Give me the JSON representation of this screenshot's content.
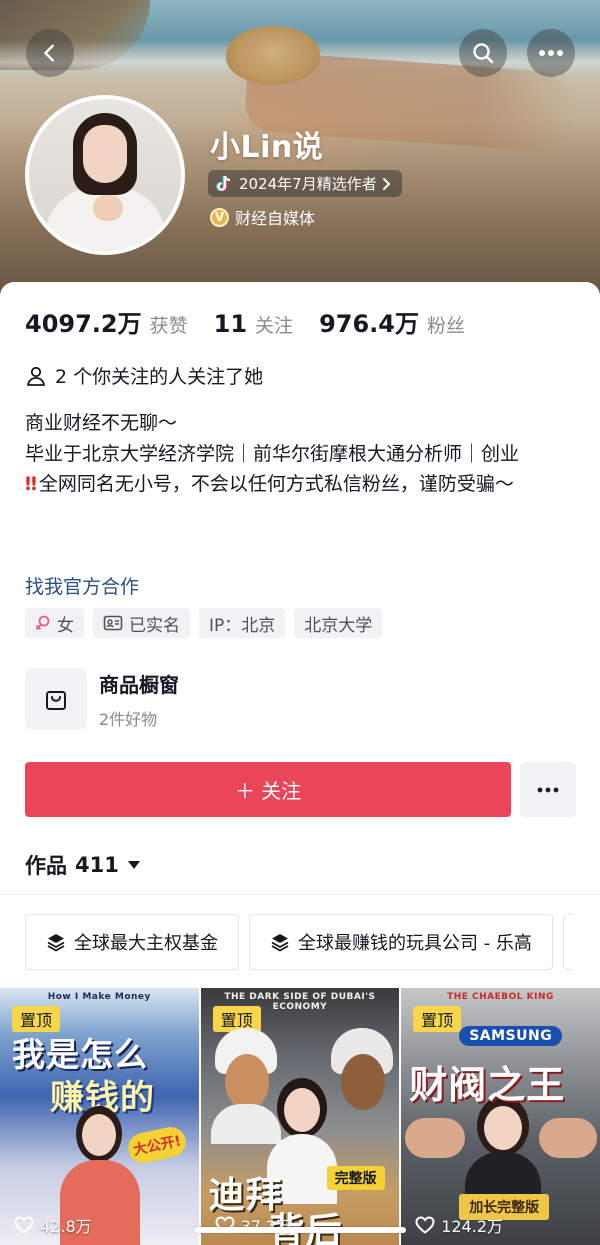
{
  "header": {
    "back_icon": "chevron-left-icon",
    "search_icon": "search-icon",
    "more_icon": "ellipsis-icon"
  },
  "profile": {
    "name": "小Lin说",
    "creator_badge": "2024年7月精选作者",
    "verified_label": "财经自媒体",
    "verified_icon_letter": "V",
    "verified_color": "#e9b84a"
  },
  "stats": {
    "likes_value": "4097.2万",
    "likes_label": "获赞",
    "following_value": "11",
    "following_label": "关注",
    "followers_value": "976.4万",
    "followers_label": "粉丝"
  },
  "mutual": {
    "text": "2 个你关注的人关注了她"
  },
  "bio": {
    "line1": "商业财经不无聊～",
    "line2": "毕业于北京大学经济学院｜前华尔街摩根大通分析师｜创业",
    "warning_mark": "‼",
    "line3": "全网同名无小号，不会以任何方式私信粉丝，谨防受骗～"
  },
  "official_link": "找我官方合作",
  "tags": [
    {
      "icon": "female-icon",
      "label": "女"
    },
    {
      "icon": "id-card-icon",
      "label": "已实名"
    },
    {
      "icon": "",
      "label": "IP：北京"
    },
    {
      "icon": "",
      "label": "北京大学"
    }
  ],
  "shop": {
    "title": "商品橱窗",
    "subtitle": "2件好物"
  },
  "actions": {
    "follow_label": "＋ 关注",
    "follow_color": "#ea4559"
  },
  "works": {
    "title": "作品",
    "count": "411"
  },
  "collections": [
    {
      "label": "全球最大主权基金"
    },
    {
      "label": "全球最赚钱的玩具公司 - 乐高"
    }
  ],
  "videos": [
    {
      "pinned_label": "置顶",
      "caption": "How I Make Money",
      "headline_1": "我是怎么",
      "headline_2": "赚钱的",
      "sticker": "大公开!",
      "likes": "42.8万"
    },
    {
      "pinned_label": "置顶",
      "caption": "THE DARK SIDE OF DUBAI'S ECONOMY",
      "headline_1": "迪拜",
      "headline_2": "背后",
      "tag": "完整版",
      "likes": "37.2万"
    },
    {
      "pinned_label": "置顶",
      "caption": "THE CHAEBOL KING",
      "brand": "SAMSUNG",
      "headline_1": "财阀之王",
      "tag": "加长完整版",
      "likes": "124.2万"
    }
  ]
}
